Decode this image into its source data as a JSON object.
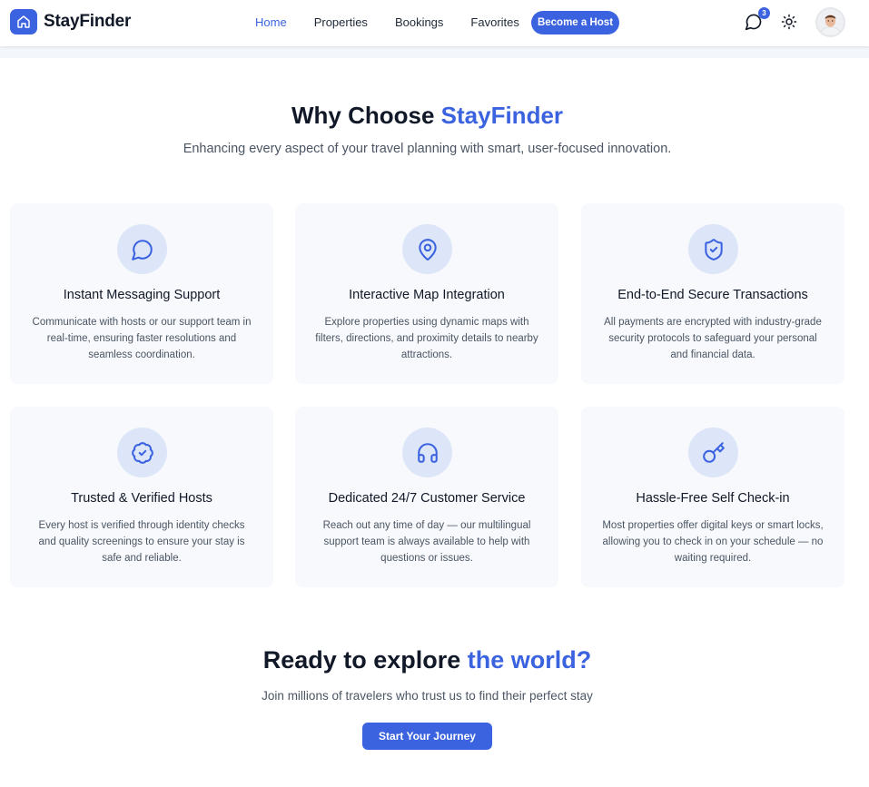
{
  "brand": {
    "name": "StayFinder",
    "icon": "home-icon"
  },
  "nav": {
    "links": [
      {
        "label": "Home",
        "active": true
      },
      {
        "label": "Properties",
        "active": false
      },
      {
        "label": "Bookings",
        "active": false
      },
      {
        "label": "Favorites",
        "active": false
      }
    ],
    "host_button": "Become a Host",
    "messages_badge": "3",
    "icons": {
      "messages": "chat-icon",
      "theme": "sun-icon",
      "avatar": "user-avatar"
    }
  },
  "why": {
    "title_prefix": "Why Choose",
    "title_accent": "StayFinder",
    "subtitle": "Enhancing every aspect of your travel planning with smart, user-focused innovation.",
    "features": [
      {
        "icon": "chat-bubble-icon",
        "title": "Instant Messaging Support",
        "desc": "Communicate with hosts or our support team in real-time, ensuring faster resolutions and seamless coordination."
      },
      {
        "icon": "map-pin-icon",
        "title": "Interactive Map Integration",
        "desc": "Explore properties using dynamic maps with filters, directions, and proximity details to nearby attractions."
      },
      {
        "icon": "shield-check-icon",
        "title": "End-to-End Secure Transactions",
        "desc": "All payments are encrypted with industry-grade security protocols to safeguard your personal and financial data."
      },
      {
        "icon": "verified-badge-icon",
        "title": "Trusted & Verified Hosts",
        "desc": "Every host is verified through identity checks and quality screenings to ensure your stay is safe and reliable."
      },
      {
        "icon": "headset-icon",
        "title": "Dedicated 24/7 Customer Service",
        "desc": "Reach out any time of day — our multilingual support team is always available to help with questions or issues."
      },
      {
        "icon": "key-icon",
        "title": "Hassle-Free Self Check-in",
        "desc": "Most properties offer digital keys or smart locks, allowing you to check in on your schedule — no waiting required."
      }
    ]
  },
  "cta": {
    "title_prefix": "Ready to explore",
    "title_accent": "the world?",
    "subtitle": "Join millions of travelers who trust us to find their perfect stay",
    "button": "Start Your Journey"
  },
  "colors": {
    "accent": "#3b63e0",
    "card_bg": "#f7f9fc",
    "icon_bg": "#dde6f8"
  }
}
